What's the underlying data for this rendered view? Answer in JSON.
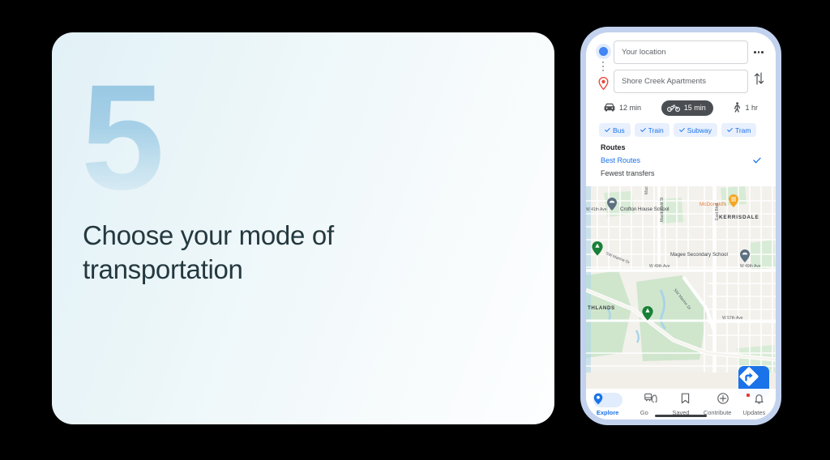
{
  "slide": {
    "step_number": "5",
    "heading": "Choose your mode of transportation",
    "accent_color": "#9ecbe4",
    "heading_color": "#24393f"
  },
  "phone": {
    "frame_color": "#c2d2ee",
    "directions": {
      "origin_value": "Your location",
      "destination_value": "Shore Creek Apartments",
      "origin_icon": "blue-dot-icon",
      "destination_icon": "red-pin-icon",
      "more_options_icon": "kebab-menu-icon",
      "swap_icon": "swap-vertical-icon"
    },
    "travel_modes": [
      {
        "icon": "car-icon",
        "duration": "12 min",
        "active": false
      },
      {
        "icon": "motorcycle-icon",
        "duration": "15 min",
        "active": true
      },
      {
        "icon": "walk-icon",
        "duration": "1 hr",
        "active": false
      }
    ],
    "transit_filters": [
      {
        "label": "Bus",
        "checked": true
      },
      {
        "label": "Train",
        "checked": true
      },
      {
        "label": "Subway",
        "checked": true
      },
      {
        "label": "Tram",
        "checked": true
      }
    ],
    "routes": {
      "title": "Routes",
      "options": [
        {
          "label": "Best Routes",
          "selected": true
        },
        {
          "label": "Fewest transfers",
          "selected": false
        }
      ]
    },
    "map": {
      "labels": {
        "poi_crofton": "Crofton House School",
        "poi_mcdonalds": "McDonald's",
        "neighborhood_kerrisdale": "KERRISDALE",
        "poi_magee": "Magee Secondary School",
        "neighborhood_southlands": "THLANDS",
        "street_mack": "Mack",
        "street_macdonald": "Macdonald St",
        "street_east_blvd": "East Blvd",
        "street_marine_a": "SW Marine Dr",
        "street_marine_b": "SW Marine Dr",
        "street_49th_a": "W 49th Ave",
        "street_49th_b": "W 49th Ave",
        "street_41st": "W 41th Ave",
        "street_57th": "W 57th Ave"
      },
      "fab_icon": "directions-turn-right-icon",
      "fab_color": "#1a73e8"
    },
    "bottom_nav": [
      {
        "label": "Explore",
        "icon": "location-pin-icon",
        "active": true,
        "badge": false
      },
      {
        "label": "Go",
        "icon": "commute-icon",
        "active": false,
        "badge": false
      },
      {
        "label": "Saved",
        "icon": "bookmark-icon",
        "active": false,
        "badge": false
      },
      {
        "label": "Contribute",
        "icon": "plus-circle-icon",
        "active": false,
        "badge": false
      },
      {
        "label": "Updates",
        "icon": "bell-icon",
        "active": false,
        "badge": true
      }
    ]
  }
}
